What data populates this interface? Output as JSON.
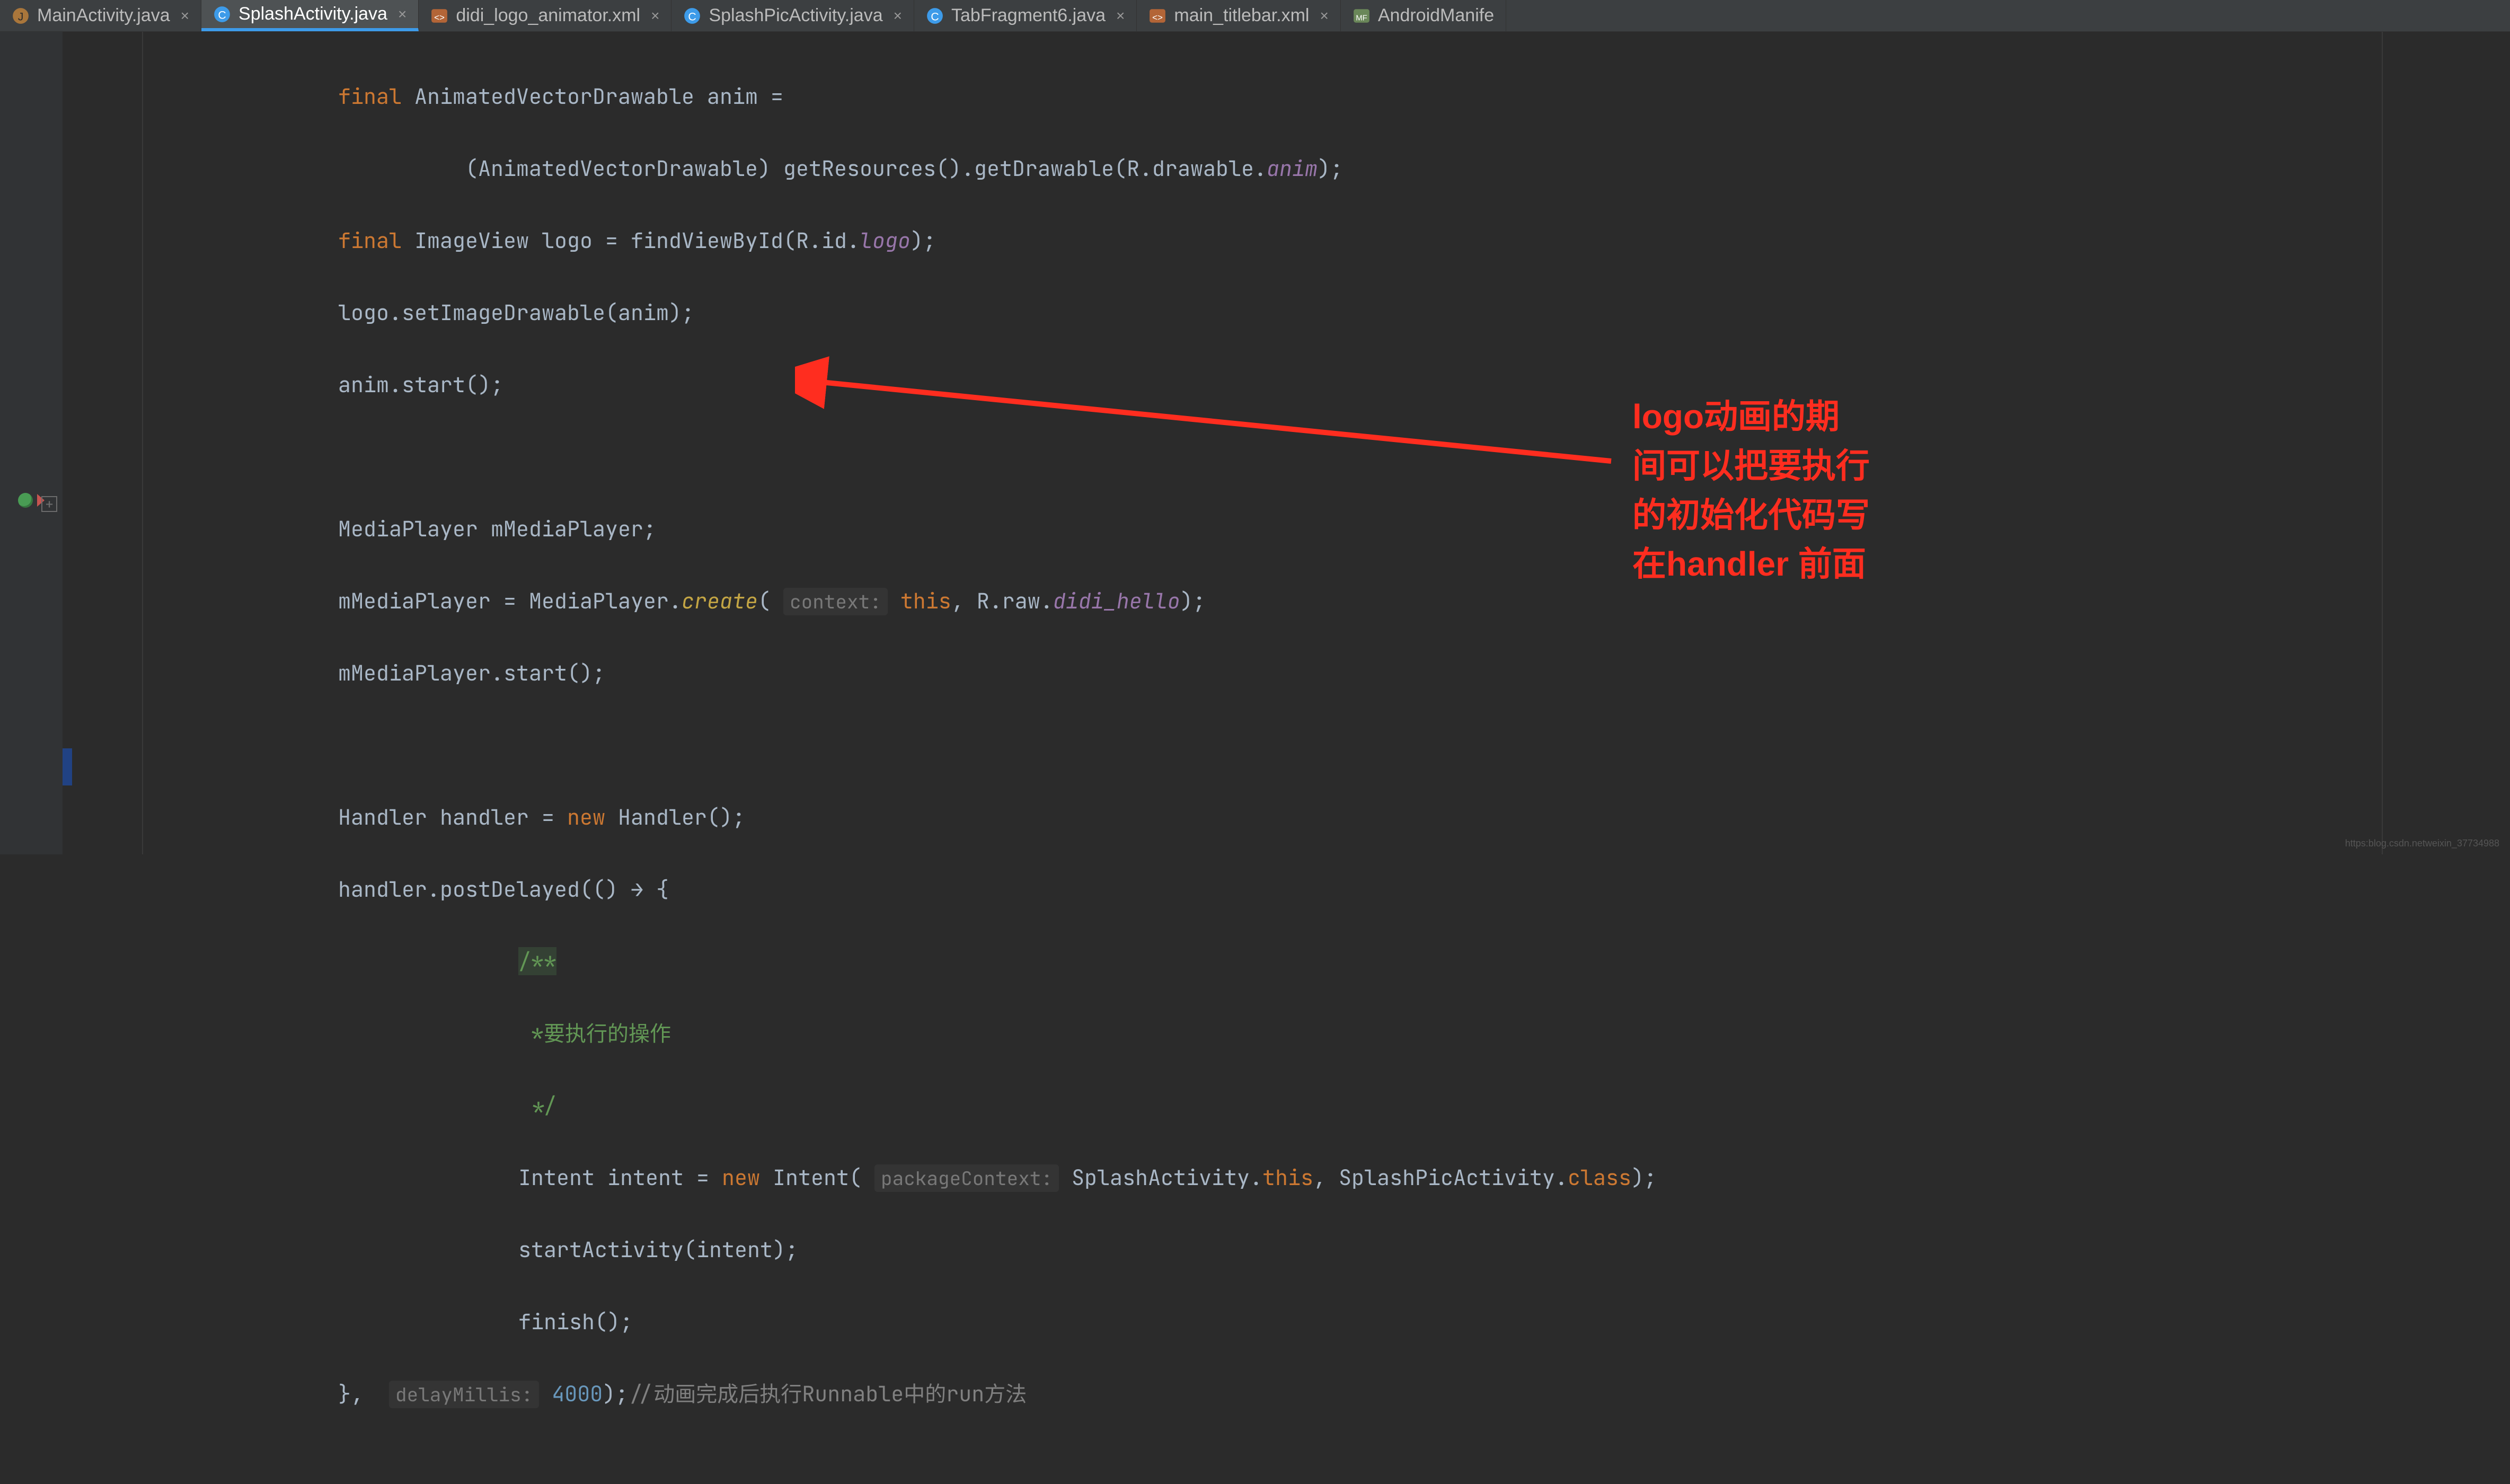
{
  "tabs": [
    {
      "label": "MainActivity.java",
      "icon": "java",
      "active": false
    },
    {
      "label": "SplashActivity.java",
      "icon": "class",
      "active": true
    },
    {
      "label": "didi_logo_animator.xml",
      "icon": "xml",
      "active": false
    },
    {
      "label": "SplashPicActivity.java",
      "icon": "class",
      "active": false
    },
    {
      "label": "TabFragment6.java",
      "icon": "class",
      "active": false
    },
    {
      "label": "main_titlebar.xml",
      "icon": "xml",
      "active": false
    },
    {
      "label": "AndroidManife",
      "icon": "manifest",
      "active": false,
      "truncated": true
    }
  ],
  "code": {
    "l1a": "final",
    "l1b": " AnimatedVectorDrawable anim =",
    "l2a": "(AnimatedVectorDrawable) getResources().getDrawable(R.drawable.",
    "l2b": "anim",
    "l2c": ");",
    "l3a": "final",
    "l3b": " ImageView logo = findViewById(R.id.",
    "l3c": "logo",
    "l3d": ");",
    "l4": "logo.setImageDrawable(anim);",
    "l5": "anim.start();",
    "l6": "",
    "l7": "MediaPlayer mMediaPlayer;",
    "l8a": "mMediaPlayer = MediaPlayer.",
    "l8b": "create",
    "l8c": "(",
    "l8hint": "context:",
    "l8d": " ",
    "l8e": "this",
    "l8f": ", R.raw.",
    "l8g": "didi_hello",
    "l8h": ");",
    "l9": "mMediaPlayer.start();",
    "l10": "",
    "l11a": "Handler handler = ",
    "l11b": "new",
    "l11c": " Handler();",
    "l12a": "handler.postDelayed(() → {",
    "l13": "/**",
    "l14": " *要执行的操作",
    "l15": " */",
    "l16a": "Intent intent = ",
    "l16b": "new",
    "l16c": " Intent(",
    "l16hint": "packageContext:",
    "l16d": " SplashActivity.",
    "l16e": "this",
    "l16f": ", SplashPicActivity.",
    "l16g": "class",
    "l16h": ");",
    "l17": "startActivity(intent);",
    "l18": "finish();",
    "l19a": "}, ",
    "l19hint": "delayMillis:",
    "l19b": " ",
    "l19c": "4000",
    "l19d": ");",
    "l19e": "//动画完成后执行Runnable中的run方法"
  },
  "annotation": "logo动画的期\n间可以把要执行\n的初始化代码写\n在handler 前面",
  "watermark": "https:blog.csdn.netweixin_37734988",
  "icons": {
    "close": "×",
    "fold": "+"
  }
}
